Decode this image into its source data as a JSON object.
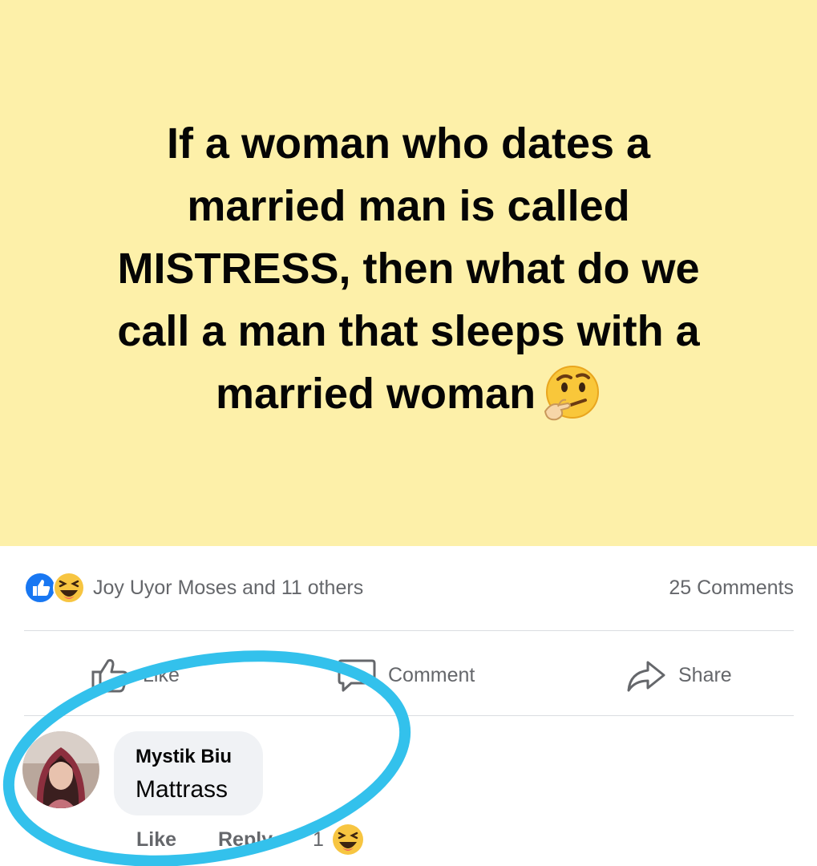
{
  "post": {
    "text_lines": [
      "If a woman who dates a",
      "married man is called",
      "MISTRESS, then what do we",
      "call a man that sleeps with a",
      "married woman"
    ],
    "background_color": "#fdf0a9",
    "trailing_emoji": "thinking-face-icon"
  },
  "reactions": {
    "icons": [
      "like-reaction-icon",
      "haha-reaction-icon"
    ],
    "names": "Joy Uyor Moses and 11 others",
    "comments": "25 Comments"
  },
  "actions": {
    "like": "Like",
    "comment": "Comment",
    "share": "Share"
  },
  "comment": {
    "author": "Mystik Biu",
    "text": "Mattrass",
    "like_label": "Like",
    "reply_label": "Reply",
    "reaction_count": "1",
    "reaction_icon": "haha-reaction-icon"
  },
  "annotation": {
    "shape": "ellipse",
    "color": "#33c1ec"
  },
  "colors": {
    "like_blue": "#1877f2",
    "haha_yellow": "#f7c541",
    "secondary_text": "#65676b"
  }
}
